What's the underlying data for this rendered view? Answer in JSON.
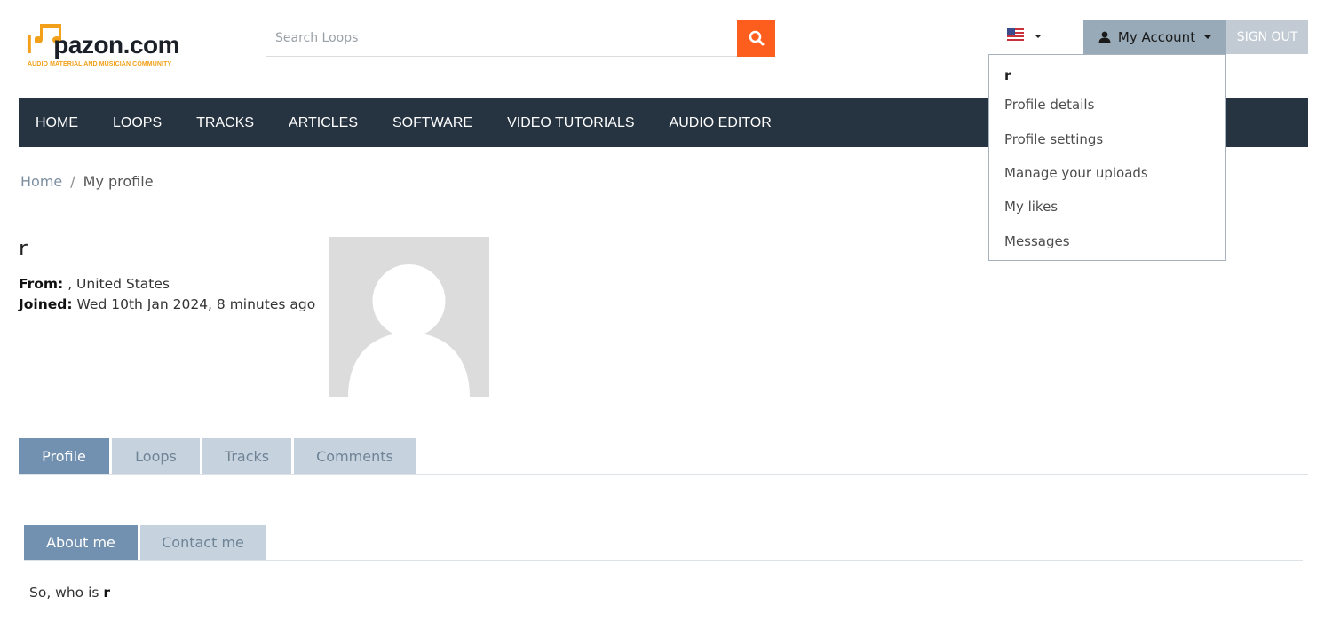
{
  "brand": {
    "logo_text_l": "l",
    "logo_text_rest": "pazon.com",
    "tagline": "AUDIO MATERIAL AND MUSICIAN COMMUNITY",
    "accent_color": "#f2a019"
  },
  "search": {
    "placeholder": "Search Loops",
    "button_icon": "search-icon",
    "button_color": "#fd5d1d"
  },
  "header": {
    "language_icon": "us-flag-icon",
    "account_label": "My Account",
    "account_icon": "user-icon",
    "signout_label": "SIGN OUT"
  },
  "nav": {
    "items": [
      "HOME",
      "LOOPS",
      "TRACKS",
      "ARTICLES",
      "SOFTWARE",
      "VIDEO TUTORIALS",
      "AUDIO EDITOR"
    ],
    "background": "#263340"
  },
  "account_menu": {
    "username": "r",
    "items": [
      "Profile details",
      "Profile settings",
      "Manage your uploads",
      "My likes",
      "Messages"
    ]
  },
  "breadcrumb": {
    "home": "Home",
    "separator": "/",
    "current": "My profile"
  },
  "profile": {
    "username": "r",
    "from_label": "From:",
    "from_value": ", United States",
    "joined_label": "Joined:",
    "joined_value": "Wed 10th Jan 2024, 8 minutes ago",
    "avatar_icon": "default-avatar-icon"
  },
  "tabs": [
    "Profile",
    "Loops",
    "Tracks",
    "Comments"
  ],
  "active_tab": "Profile",
  "subtabs": [
    "About me",
    "Contact me"
  ],
  "active_subtab": "About me",
  "about": {
    "prefix": "So, who is",
    "name": "r"
  }
}
